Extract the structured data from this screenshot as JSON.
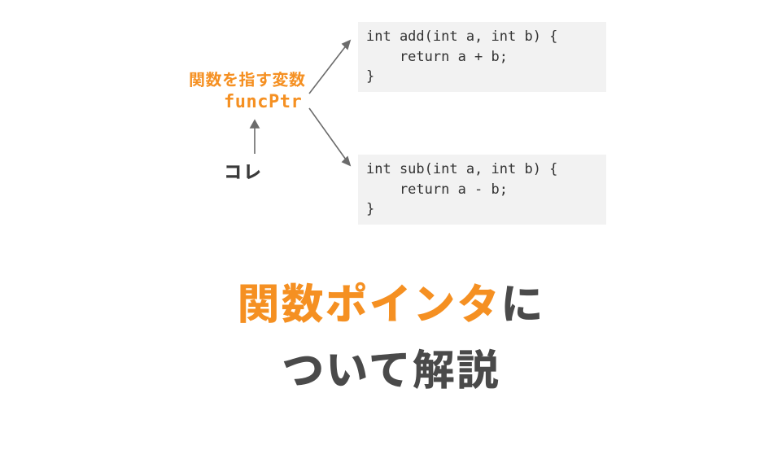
{
  "colors": {
    "accent": "#f59022",
    "text_dark": "#4a4a4a",
    "code_bg": "#f2f2f2"
  },
  "diagram": {
    "variable_desc": "関数を指す変数",
    "funcptr_name": "funcPtr",
    "pointer_label": "コレ",
    "code_top": "int add(int a, int b) {\n    return a + b;\n}",
    "code_bottom": "int sub(int a, int b) {\n    return a - b;\n}"
  },
  "title": {
    "line1_orange": "関数ポインタ",
    "line1_rest": "に",
    "line2": "ついて解説"
  }
}
